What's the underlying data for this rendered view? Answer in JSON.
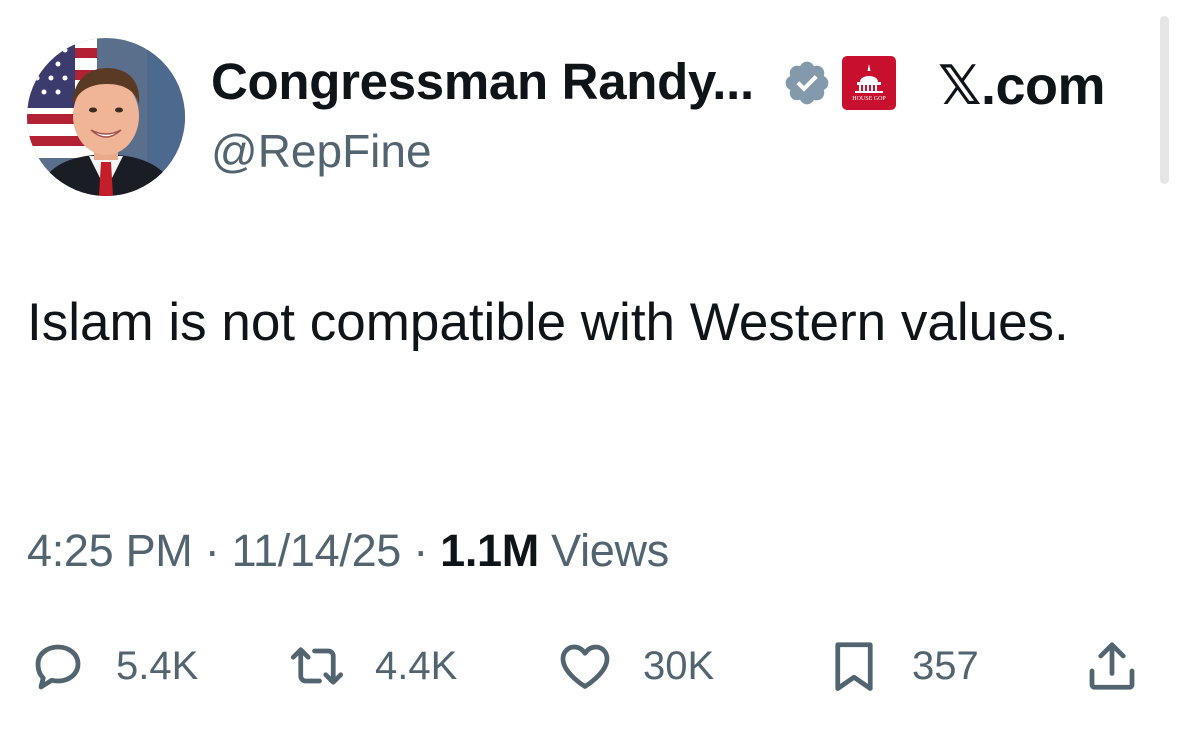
{
  "author": {
    "display_name": "Congressman Randy...",
    "handle": "@RepFine",
    "verified_badge": "verified-badge-icon",
    "affiliation_badge": "house-gop-capitol-icon",
    "affiliation_badge_text": "HOUSE GOP"
  },
  "site_logo": "𝕏.com",
  "tweet": {
    "text": "Islam is not compatible with Western values."
  },
  "meta": {
    "time": "4:25 PM",
    "date": "11/14/25",
    "separator": "·",
    "views_count": "1.1M",
    "views_label": "Views"
  },
  "actions": {
    "reply": {
      "icon": "reply-icon",
      "count": "5.4K"
    },
    "repost": {
      "icon": "repost-icon",
      "count": "4.4K"
    },
    "like": {
      "icon": "heart-icon",
      "count": "30K"
    },
    "bookmark": {
      "icon": "bookmark-icon",
      "count": "357"
    },
    "share": {
      "icon": "share-icon"
    }
  },
  "colors": {
    "text_primary": "#0f1419",
    "text_secondary": "#536471",
    "verified_badge": "#829aab",
    "affiliation_badge": "#c8102e"
  }
}
